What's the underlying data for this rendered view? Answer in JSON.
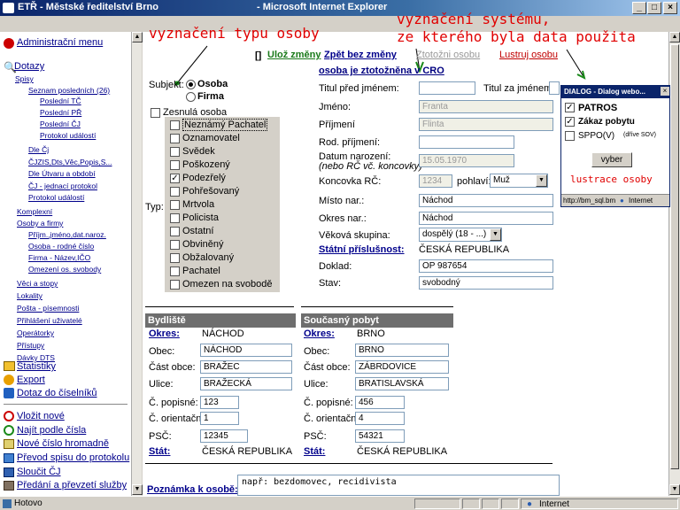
{
  "window": {
    "app_title": "ETŘ - Městské ředitelství Brno",
    "browser_title": "- Microsoft Internet Explorer",
    "buttons": [
      "_",
      "□",
      "×"
    ]
  },
  "annotations": {
    "type_label": "vyznačení typu osoby",
    "system_label_1": "vyznačení systému,",
    "system_label_2": "ze kterého byla data použita",
    "lustrace_label": "lustrace osoby"
  },
  "sidebar": {
    "admin": "Administrační menu",
    "dotazy": "Dotazy",
    "spisy": "Spisy",
    "seznam": "Seznam posledních (26)",
    "posledni_tc": "Poslední TČ",
    "posledni_pr": "Poslední PŘ",
    "posledni_cj": "Poslední ČJ",
    "protokol_udalosti": "Protokol událostí",
    "dle_cj": "Dle Čj",
    "cjzis": "ČJZIS,Dts,Věc,Popis,S...",
    "dle_utvaru": "Dle Útvaru a období",
    "cj_jednaci": "ČJ - jednací protokol",
    "protokol_udalosti2": "Protokol událostí",
    "komplexni": "Komplexní",
    "osoby": "Osoby a firmy",
    "prijm": "Příjm.,jméno,dat.naroz.",
    "osoba_rc": "Osoba - rodné číslo",
    "firma": "Firma - Název,IČO",
    "omezeni": "Omezení os. svobody",
    "veci": "Věci a stopy",
    "lokality": "Lokality",
    "posta": "Pošta - písemnosti",
    "prihlaseni": "Přihlášení uživatelé",
    "operatorky": "Operátorky",
    "pristupy": "Přístupy",
    "davky": "Dávky DTS",
    "statistiky": "Statistiky",
    "export": "Export",
    "dotaz_ciselnik": "Dotaz do číselníků",
    "vlozit": "Vložit nové",
    "najit": "Najít podle čísla",
    "nove_cislo": "Nové číslo hromadně",
    "prevod": "Převod spisu do protokolu",
    "sloucit": "Sloučit ČJ",
    "predani": "Předání a převzetí služby"
  },
  "toolbar": {
    "bracket": "[]",
    "uloz": "Ulož změny",
    "zpet": "Zpět bez změny",
    "ztotozni": "Ztotožni osobu",
    "lustruj": "Lustruj osobu",
    "identified": "osoba je ztotožněna v CRO"
  },
  "subjekt": {
    "label": "Subjekt:",
    "osoba": "Osoba",
    "firma": "Firma",
    "zesnula": "Zesnulá osoba"
  },
  "typ": {
    "label": "Typ:",
    "items": [
      {
        "label": "Neznámý Pachatel",
        "checked": false,
        "selected": true
      },
      {
        "label": "Oznamovatel",
        "checked": false
      },
      {
        "label": "Svědek",
        "checked": false
      },
      {
        "label": "Poškozený",
        "checked": false
      },
      {
        "label": "Podezřelý",
        "checked": true
      },
      {
        "label": "Pohřešovaný",
        "checked": false
      },
      {
        "label": "Mrtvola",
        "checked": false
      },
      {
        "label": "Policista",
        "checked": false
      },
      {
        "label": "Ostatní",
        "checked": false
      },
      {
        "label": "Obviněný",
        "checked": false
      },
      {
        "label": "Obžalovaný",
        "checked": false
      },
      {
        "label": "Pachatel",
        "checked": false
      },
      {
        "label": "Omezen na svobodě",
        "checked": false
      }
    ]
  },
  "person": {
    "titul_pred_label": "Titul před jménem:",
    "titul_pred": "",
    "titul_za_label": "Titul za jménem:",
    "titul_za": "",
    "jmeno_label": "Jméno:",
    "jmeno": "Franta",
    "prijmeni_label": "Příjmení",
    "prijmeni": "Flinta",
    "rod_prijmeni_label": "Rod. příjmení:",
    "rod_prijmeni": "",
    "datum_label": "Datum narození:",
    "datum_note": "(nebo RČ vč. koncovky)",
    "datum": "15.05.1970",
    "koncovka_label": "Koncovka RČ:",
    "koncovka": "1234",
    "pohlavi_label": "pohlaví:",
    "pohlavi": "Muž",
    "misto_label": "Místo nar.:",
    "misto": "Náchod",
    "okres_label": "Okres nar.:",
    "okres": "Náchod",
    "vekova_label": "Věková skupina:",
    "vekova": "dospělý (18 - ...)",
    "statni_label": "Státní příslušnost:",
    "statni": "ČESKÁ REPUBLIKA",
    "doklad_label": "Doklad:",
    "doklad": "OP 987654",
    "stav_label": "Stav:",
    "stav": "svobodný"
  },
  "bydliste": {
    "title": "Bydliště",
    "okres_label": "Okres:",
    "okres": "NÁCHOD",
    "obec_label": "Obec:",
    "obec": "NÁCHOD",
    "cast_label": "Část obce:",
    "cast": "BRAŽEC",
    "ulice_label": "Ulice:",
    "ulice": "BRAŽECKÁ",
    "cp_label": "Č. popisné:",
    "cp": "123",
    "co_label": "Č. orientační:",
    "co": "1",
    "psc_label": "PSČ:",
    "psc": "12345",
    "stat_label": "Stát:",
    "stat": "ČESKÁ REPUBLIKA"
  },
  "soucasny": {
    "title": "Současný pobyt",
    "okres_label": "Okres:",
    "okres": "BRNO",
    "obec_label": "Obec:",
    "obec": "BRNO",
    "cast_label": "Část obce:",
    "cast": "ZÁBRDOVICE",
    "ulice_label": "Ulice:",
    "ulice": "BRATISLAVSKÁ",
    "cp_label": "Č. popisné:",
    "cp": "456",
    "co_label": "Č. orientační:",
    "co": "4",
    "psc_label": "PSČ:",
    "psc": "54321",
    "stat_label": "Stát:",
    "stat": "ČESKÁ REPUBLIKA"
  },
  "poznamka": {
    "label": "Poznámka k osobě:",
    "value": "např: bezdomovec, recidivista"
  },
  "dialog": {
    "title": "DIALOG - Dialog webo...",
    "patros": "PATROS",
    "zakaz": "Zákaz pobytu",
    "sppo": "SPPO(V)",
    "sppo_note": "(dříve SOV)",
    "button": "vyber",
    "url": "http://bm_sql.bm",
    "zone": "Internet"
  },
  "status": {
    "left": "Hotovo",
    "zone": "Internet"
  }
}
